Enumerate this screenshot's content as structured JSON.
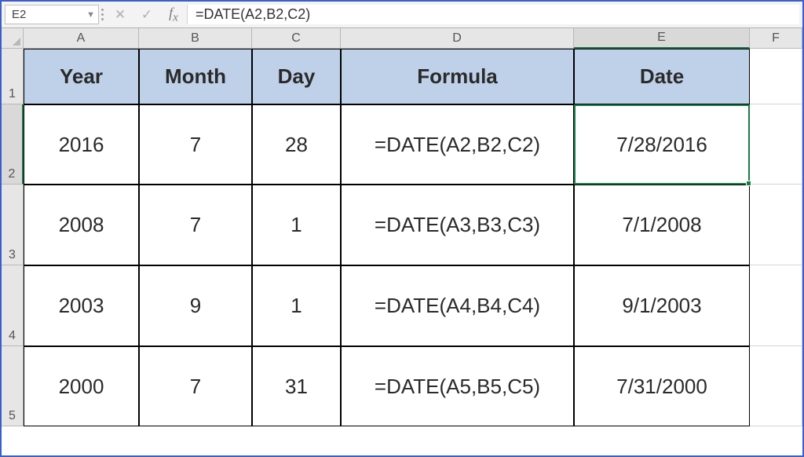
{
  "formula_bar": {
    "name_box": "E2",
    "formula": "=DATE(A2,B2,C2)"
  },
  "columns": [
    "A",
    "B",
    "C",
    "D",
    "E",
    "F"
  ],
  "active_column": "E",
  "active_row": "2",
  "row_labels": [
    "1",
    "2",
    "3",
    "4",
    "5"
  ],
  "headers": {
    "year": "Year",
    "month": "Month",
    "day": "Day",
    "formula": "Formula",
    "date": "Date"
  },
  "rows": [
    {
      "year": "2016",
      "month": "7",
      "day": "28",
      "formula": "=DATE(A2,B2,C2)",
      "date": "7/28/2016"
    },
    {
      "year": "2008",
      "month": "7",
      "day": "1",
      "formula": "=DATE(A3,B3,C3)",
      "date": "7/1/2008"
    },
    {
      "year": "2003",
      "month": "9",
      "day": "1",
      "formula": "=DATE(A4,B4,C4)",
      "date": "9/1/2003"
    },
    {
      "year": "2000",
      "month": "7",
      "day": "31",
      "formula": "=DATE(A5,B5,C5)",
      "date": "7/31/2000"
    }
  ],
  "selected_cell": "E2"
}
